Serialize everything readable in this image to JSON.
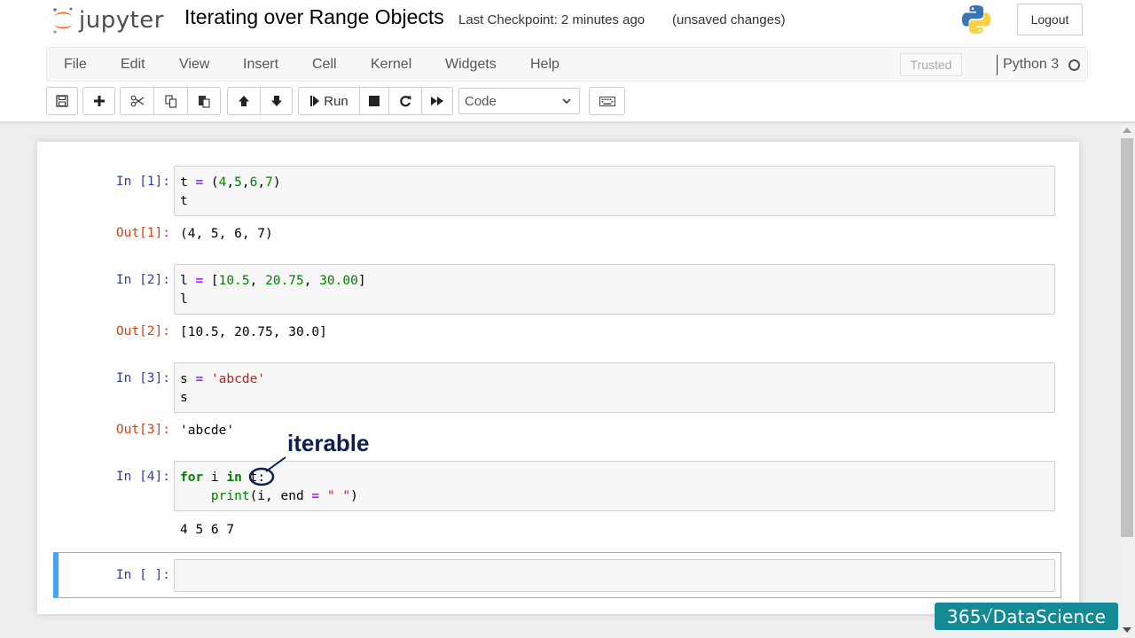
{
  "header": {
    "logo_text": "jupyter",
    "notebook_title": "Iterating over Range Objects",
    "checkpoint": "Last Checkpoint: 2 minutes ago",
    "unsaved": "(unsaved changes)",
    "logout_label": "Logout"
  },
  "menubar": {
    "items": [
      "File",
      "Edit",
      "View",
      "Insert",
      "Cell",
      "Kernel",
      "Widgets",
      "Help"
    ],
    "trusted_label": "Trusted",
    "kernel_name": "Python 3"
  },
  "toolbar": {
    "run_label": "Run",
    "cell_type": "Code"
  },
  "cells": [
    {
      "in_prompt": "In [1]:",
      "out_prompt": "Out[1]:",
      "output": "(4, 5, 6, 7)"
    },
    {
      "in_prompt": "In [2]:",
      "out_prompt": "Out[2]:",
      "output": "[10.5, 20.75, 30.0]"
    },
    {
      "in_prompt": "In [3]:",
      "out_prompt": "Out[3]:",
      "output": "'abcde'"
    },
    {
      "in_prompt": "In [4]:",
      "output": "4 5 6 7"
    },
    {
      "in_prompt": "In [ ]:"
    }
  ],
  "code": {
    "c1_l1": [
      "t",
      " ",
      "=",
      " (",
      "4",
      ",",
      "5",
      ",",
      "6",
      ",",
      "7",
      ")"
    ],
    "c1_l2": "t",
    "c2_l1": [
      "l",
      " ",
      "=",
      " [",
      "10.5",
      ", ",
      "20.75",
      ", ",
      "30.00",
      "]"
    ],
    "c2_l2": "l",
    "c3_l1": [
      "s",
      " ",
      "=",
      " ",
      "'abcde'"
    ],
    "c3_l2": "s",
    "c4_l1": [
      "for",
      " i ",
      "in",
      " t:"
    ],
    "c4_l2": [
      "    ",
      "print",
      "(i, end ",
      "=",
      " ",
      "\" \"",
      ")"
    ]
  },
  "annotation": {
    "label": "iterable"
  },
  "branding": {
    "text": "365√DataScience"
  }
}
